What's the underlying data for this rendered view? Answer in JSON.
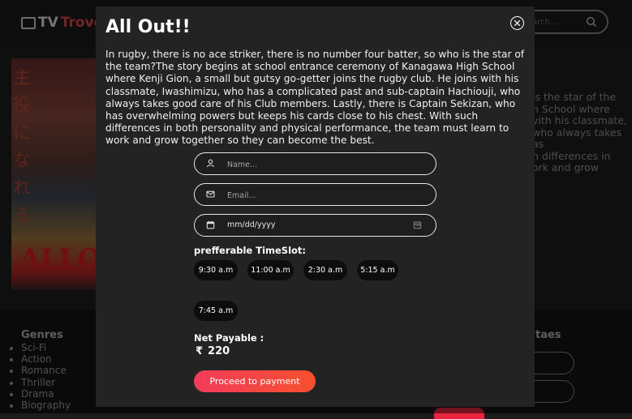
{
  "background": {
    "logo": {
      "tv": "TV",
      "trove": "Trove"
    },
    "search_placeholder": "earch...",
    "description_fragment": [
      "is the star of the",
      "h School where",
      "vith his classmate,",
      "who always takes",
      "as",
      "n differences in",
      "ork and grow"
    ],
    "genres_title": "Genres",
    "genres": [
      "Sci-Fi",
      "Action",
      "Romance",
      "Thriller",
      "Drama",
      "Biography"
    ],
    "right_column_title": "taes",
    "poster_title": "ALLO",
    "poster_kanji": "主役になれる"
  },
  "modal": {
    "title": "All Out!!",
    "description": "In rugby, there is no ace striker, there is no number four batter, so who is the star of the team?The story begins at school entrance ceremony of Kanagawa High School where Kenji Gion, a small but gutsy go-getter joins the rugby club. He joins with his classmate, Iwashimizu, who has a complicated past and sub-captain Hachiouji, who always takes good care of his Club members. Lastly, there is Captain Sekizan, who has overwhelming powers but keeps his cards close to his chest. With such differences in both personality and physical performance, the team must learn to work and grow together so they can become the best.",
    "name_placeholder": "Name...",
    "email_placeholder": "Email...",
    "date_placeholder": "mm/dd/yyyy",
    "timeslot_label": "prefferable TimeSlot:",
    "timeslots": [
      "9:30 a.m",
      "11:00 a.m",
      "2:30 a.m",
      "5:15 a.m",
      "7:45 a.m"
    ],
    "net_payable_label": "Net Payable :",
    "currency_symbol": "₹",
    "amount": "220",
    "proceed_button": "Proceed to payment"
  },
  "colors": {
    "accent_start": "#f23c5a",
    "accent_end": "#f7502f",
    "modal_bg": "#232323"
  }
}
